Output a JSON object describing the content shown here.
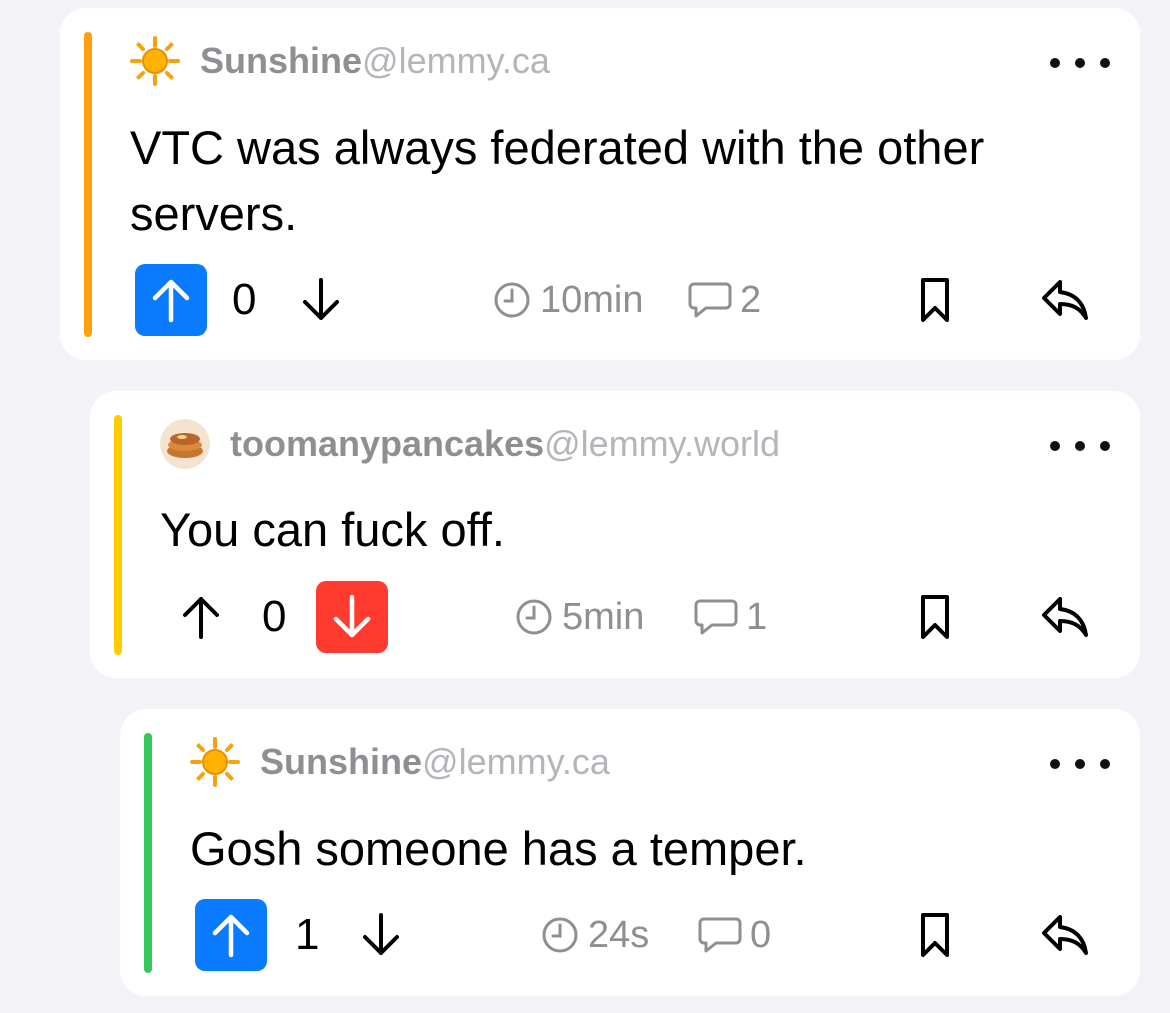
{
  "colors": {
    "background": "#f2f2f7",
    "card": "#ffffff",
    "upvote_active": "#0a7aff",
    "downvote_active": "#ff3b30",
    "thread_level_1": "#ff9f0a",
    "thread_level_2": "#ffcc00",
    "thread_level_3": "#34c759",
    "meta_text": "#8e8e93"
  },
  "comments": [
    {
      "author": "Sunshine",
      "instance": "@lemmy.ca",
      "avatar_icon": "sun-emoji-avatar",
      "body": "VTC was always federated with the other servers.",
      "score": "0",
      "vote": "up",
      "age": "10min",
      "replies": "2"
    },
    {
      "author": "toomanypancakes",
      "instance": "@lemmy.world",
      "avatar_icon": "pancake-photo-avatar",
      "body": "You can fuck off.",
      "score": "0",
      "vote": "down",
      "age": "5min",
      "replies": "1"
    },
    {
      "author": "Sunshine",
      "instance": "@lemmy.ca",
      "avatar_icon": "sun-emoji-avatar",
      "body": "Gosh someone has a temper.",
      "score": "1",
      "vote": "up",
      "age": "24s",
      "replies": "0"
    }
  ]
}
